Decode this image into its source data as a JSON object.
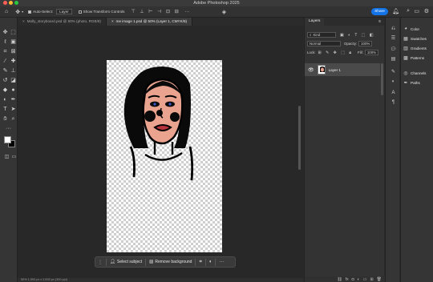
{
  "app": {
    "title": "Adobe Photoshop 2025"
  },
  "options": {
    "auto_select_label": "Auto-Select:",
    "auto_select_target": "Layer",
    "transform_controls_label": "Show Transform Controls",
    "share_label": "Share"
  },
  "tabs": [
    {
      "label": "Molly_storyboard.psd @ 50% (photo, RGB/8)"
    },
    {
      "label": "me image 1.psd @ 50% (Layer 1, CMYK/8)"
    }
  ],
  "taskbar": {
    "select_subject": "Select subject",
    "remove_background": "Remove background"
  },
  "status": {
    "text": "50%   1,593 px x 2,833 px (300 ppi)"
  },
  "layers_panel": {
    "tab_label": "Layers",
    "kind_label": "Kind",
    "blend_mode": "Normal",
    "opacity_label": "Opacity:",
    "opacity_value": "100%",
    "lock_label": "Lock:",
    "fill_label": "Fill:",
    "fill_value": "100%",
    "layers": [
      {
        "name": "Layer 1"
      }
    ]
  },
  "side_panels": [
    {
      "label": "Color",
      "icon": "color-wheel-icon"
    },
    {
      "label": "Swatches",
      "icon": "swatches-grid-icon"
    },
    {
      "label": "Gradients",
      "icon": "gradient-icon"
    },
    {
      "label": "Patterns",
      "icon": "pattern-icon"
    },
    {
      "label": "Channels",
      "icon": "channels-icon"
    },
    {
      "label": "Paths",
      "icon": "paths-icon"
    }
  ],
  "colors": {
    "accent": "#1473e6",
    "skin": "#e9a38f",
    "foreground_swatch": "#ffffff",
    "background_swatch": "#000000"
  }
}
